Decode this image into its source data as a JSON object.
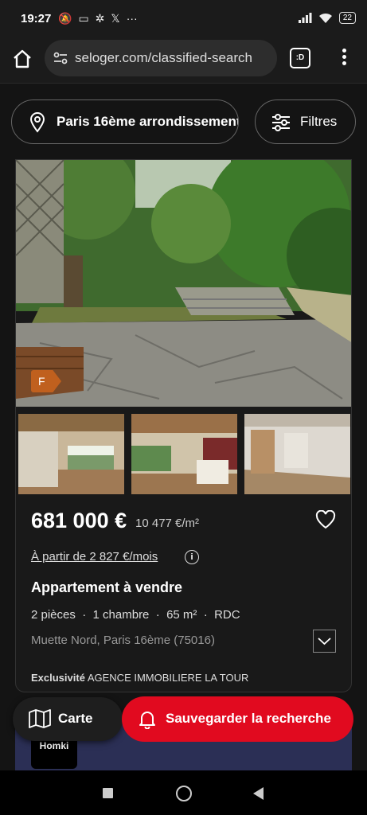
{
  "status_bar": {
    "time": "19:27",
    "left_icons": [
      "mute-bell-icon",
      "screencast-icon",
      "notification-icon",
      "x-icon",
      "more-icon"
    ],
    "more": "···",
    "x": "𝕏",
    "battery": "22"
  },
  "browser": {
    "url": "seloger.com/classified-search",
    "tab_label": ":D"
  },
  "search": {
    "location": "Paris 16ème arrondissement",
    "filters_label": "Filtres"
  },
  "listing": {
    "energy_class": "F",
    "price": "681 000 €",
    "price_per_m2": "10 477 €/m²",
    "monthly": "À partir de 2 827 €/mois",
    "info": "i",
    "property_type": "Appartement à vendre",
    "features": "2 pièces  ·  1 chambre  ·  65 m²  ·  RDC",
    "address": "Muette Nord, Paris 16ème (75016)",
    "exclusive_label": "Exclusivité",
    "agency": "AGENCE IMMOBILIERE LA TOUR"
  },
  "next_listing": {
    "brand": "Homki"
  },
  "actions": {
    "map_label": "Carte",
    "save_search_label": "Sauvegarder la recherche"
  },
  "colors": {
    "accent_red": "#e10a1f",
    "energy_f": "#c0601e",
    "background": "#141414"
  }
}
